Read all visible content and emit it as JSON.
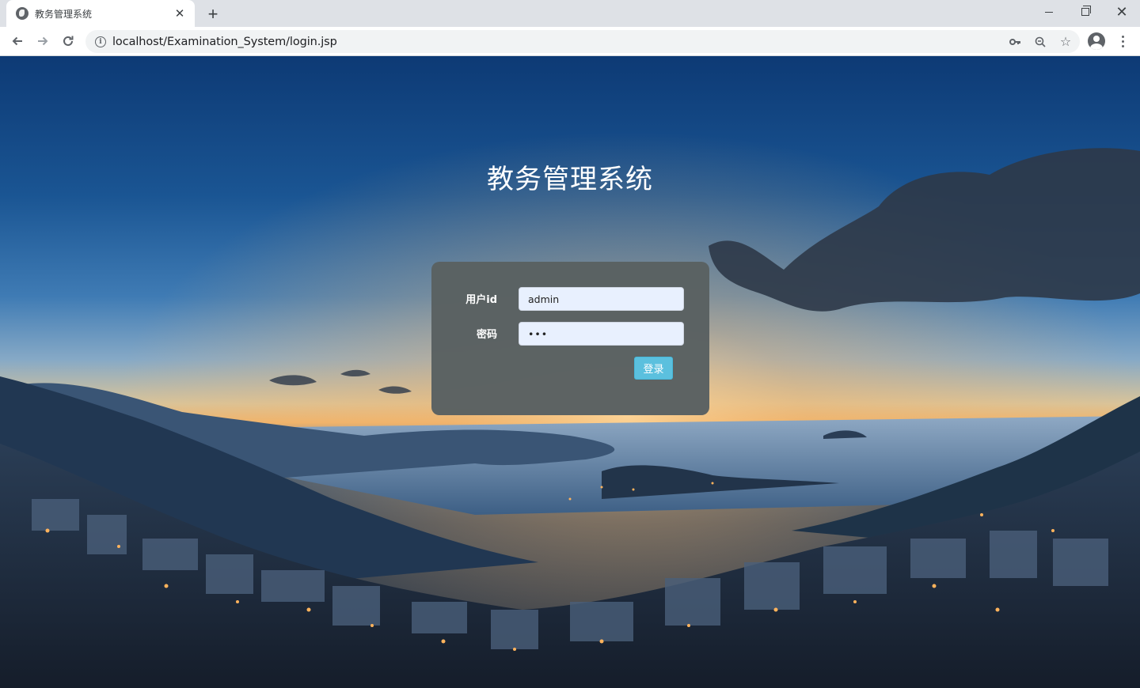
{
  "browser": {
    "tab": {
      "title": "教务管理系统",
      "close_glyph": "✕",
      "favicon": "globe-icon"
    },
    "new_tab_glyph": "+",
    "address": {
      "url": "localhost/Examination_System/login.jsp",
      "info_glyph": "i"
    },
    "nav": {
      "back_glyph": "←",
      "forward_glyph": "→",
      "reload_glyph": "↻"
    },
    "icons": {
      "key": "key-icon",
      "zoom": "zoom-icon",
      "star": "☆",
      "profile": "profile-icon",
      "menu": "menu-icon"
    },
    "window": {
      "close_glyph": "✕"
    }
  },
  "page": {
    "title": "教务管理系统",
    "form": {
      "user_label": "用户id",
      "user_value": "admin",
      "password_label": "密码",
      "password_value": "•••",
      "submit_label": "登录"
    }
  },
  "colors": {
    "panel": "#5a6162",
    "button": "#5bc0de",
    "input_bg": "#e8f0fe",
    "sky_top": "#0d3a75",
    "sunset": "#f0b36a"
  }
}
